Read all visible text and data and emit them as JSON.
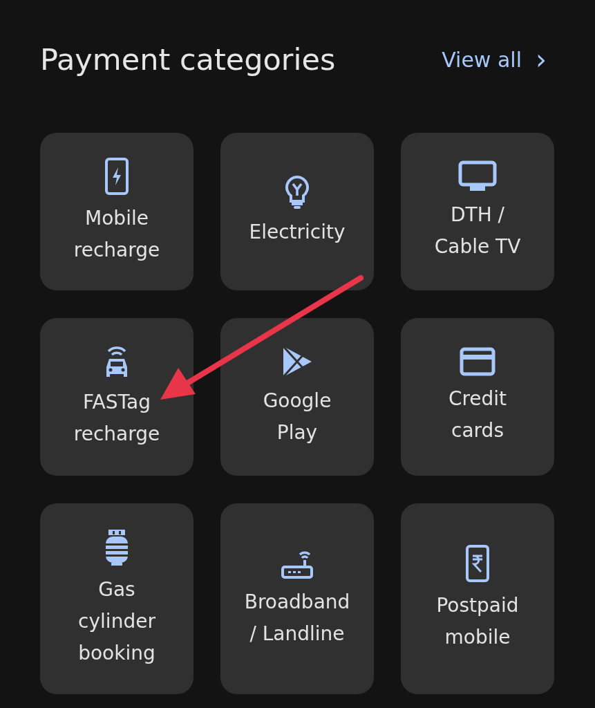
{
  "header": {
    "title": "Payment categories",
    "link": "View all",
    "chevron": "›"
  },
  "categories": [
    {
      "label": "Mobile\nrecharge"
    },
    {
      "label": "Electricity"
    },
    {
      "label": "DTH /\nCable TV"
    },
    {
      "label": "FASTag\nrecharge"
    },
    {
      "label": "Google\nPlay"
    },
    {
      "label": "Credit\ncards"
    },
    {
      "label": "Gas\ncylinder\nbooking"
    },
    {
      "label": "Broadband\n/ Landline"
    },
    {
      "label": "Postpaid\nmobile"
    }
  ],
  "overlay": {
    "kind": "arrow"
  }
}
